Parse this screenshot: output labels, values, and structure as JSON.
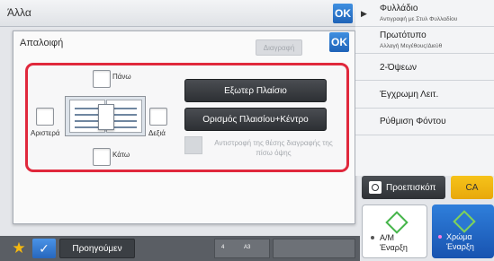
{
  "topbar": {
    "label": "Άλλα",
    "ok": "OK"
  },
  "dialog": {
    "title": "Απαλοιφή",
    "erase_button": "Διαγραφή",
    "ok": "OK",
    "checkboxes": {
      "top": "Πάνω",
      "left": "Αριστερά",
      "right": "Δεξιά",
      "bottom": "Κάτω"
    },
    "buttons": {
      "outer_frame": "Εξωτερ Πλαίσιο",
      "frame_center": "Ορισμός Πλαισίου+Κέντρο"
    },
    "reverse_option": "Αντιστροφή της θέσης διαγραφής της πίσω όψης"
  },
  "right_panel": {
    "items": [
      {
        "title": "Φυλλάδιο",
        "subtitle": "Αντιγραφή με Στυλ Φυλλαδίου"
      },
      {
        "title": "Πρωτότυπο",
        "subtitle": "Αλλαγή Μεγέθους/Διεύθ"
      },
      {
        "title": "2-Όψεων",
        "subtitle": ""
      },
      {
        "title": "Έγχρωμη Λειτ.",
        "subtitle": ""
      },
      {
        "title": "Ρύθμιση Φόντου",
        "subtitle": ""
      }
    ],
    "preview_button": "Προεπισκόπ",
    "ca_button": "CA",
    "start_bw": {
      "line1": "A/M",
      "line2": "Έναρξη"
    },
    "start_color": {
      "line1": "Χρώμα",
      "line2": "Έναρξη"
    }
  },
  "bottom_bar": {
    "back_button": "Προηγούμεν",
    "tray_number": "4",
    "tray_size": "A3"
  },
  "colors": {
    "ok_blue": "#1f63b8",
    "highlight_red": "#e0283c",
    "ca_yellow": "#f6c31a",
    "color_start_blue": "#2f7fdb"
  }
}
